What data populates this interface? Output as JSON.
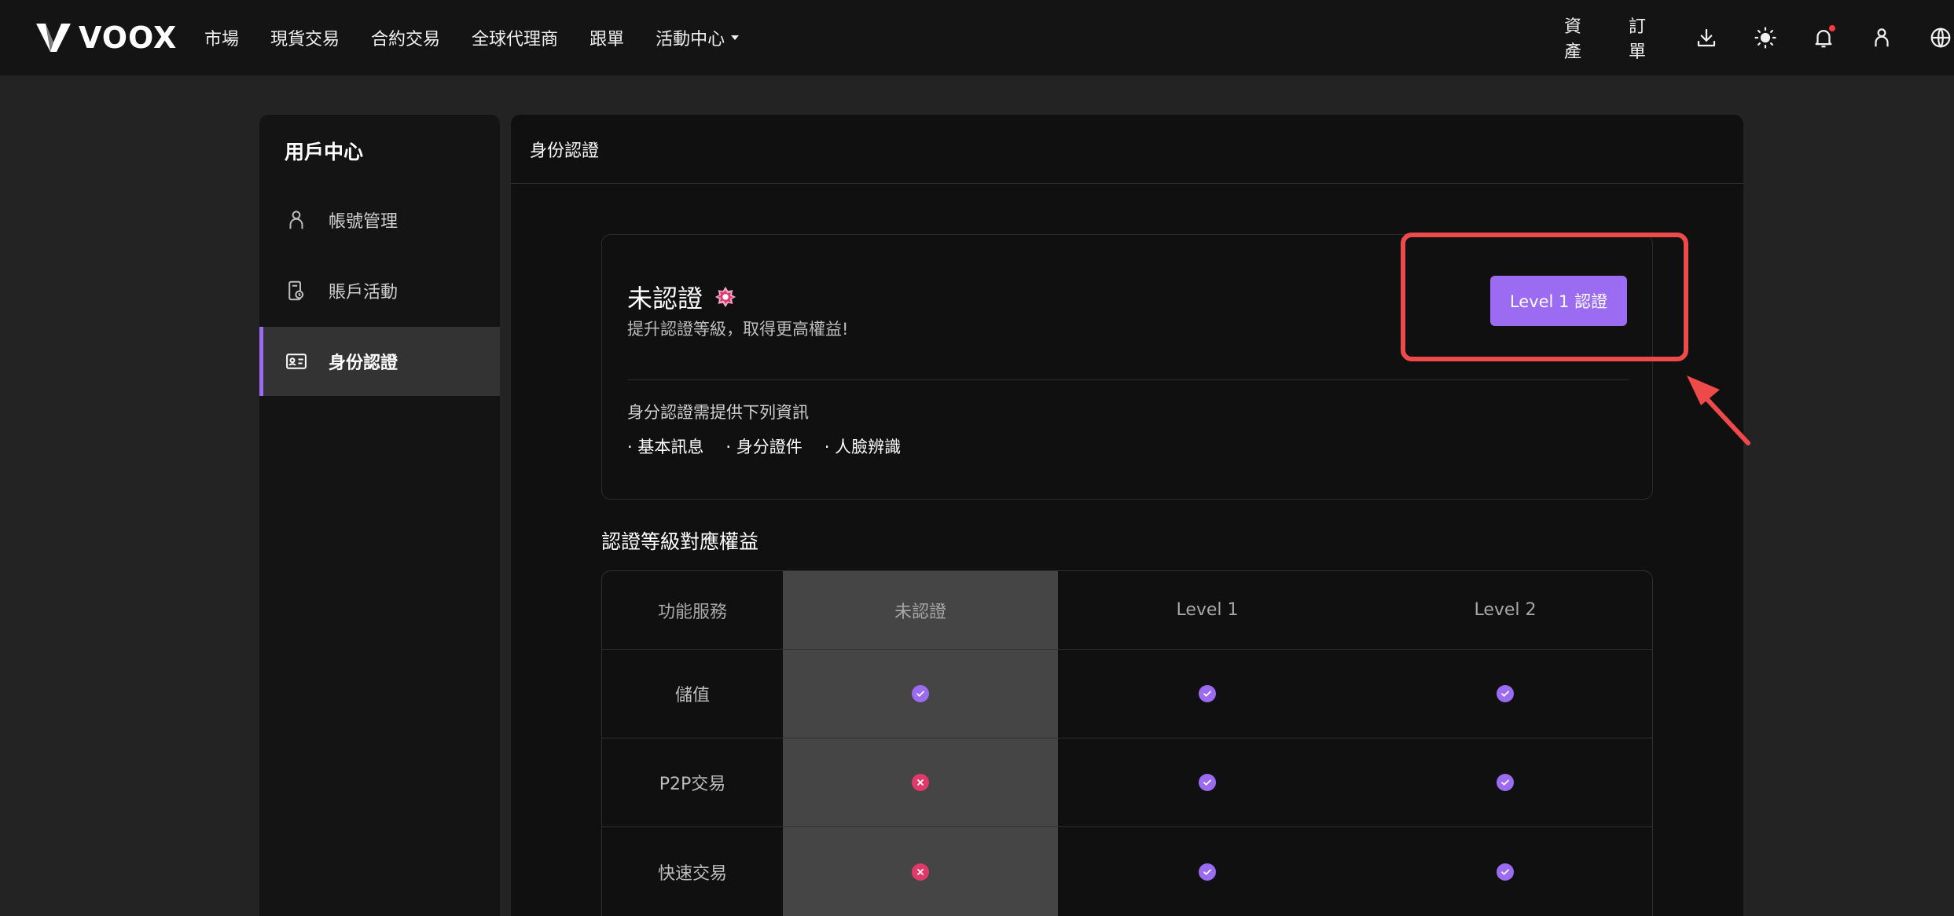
{
  "app": {
    "brand": "VOOX"
  },
  "nav": {
    "items": [
      "市場",
      "現貨交易",
      "合約交易",
      "全球代理商",
      "跟單",
      "活動中心"
    ],
    "right": {
      "assets": "資產",
      "orders": "訂單"
    },
    "icons": [
      "download-icon",
      "sun-icon",
      "bell-icon",
      "user-icon",
      "globe-icon"
    ]
  },
  "sidebar": {
    "title": "用戶中心",
    "items": [
      {
        "label": "帳號管理",
        "icon": "user-icon"
      },
      {
        "label": "賬戶活動",
        "icon": "activity-icon"
      },
      {
        "label": "身份認證",
        "icon": "id-card-icon",
        "active": true
      }
    ]
  },
  "main": {
    "title": "身份認證",
    "status": {
      "title": "未認證",
      "subtitle": "提升認證等級，取得更高權益!",
      "button_label": "Level 1 認證",
      "requirements_title": "身分認證需提供下列資訊",
      "requirements": [
        "· 基本訊息",
        "· 身分證件",
        "· 人臉辨識"
      ]
    },
    "benefits_title": "認證等級對應權益",
    "table": {
      "headers": [
        "功能服務",
        "未認證",
        "Level 1",
        "Level 2"
      ],
      "rows": [
        {
          "label": "儲值",
          "values": [
            true,
            true,
            true
          ]
        },
        {
          "label": "P2P交易",
          "values": [
            false,
            true,
            true
          ]
        },
        {
          "label": "快速交易",
          "values": [
            false,
            true,
            true
          ]
        }
      ]
    }
  },
  "colors": {
    "accent": "#9b6bf2",
    "cross": "#e0396b",
    "highlight": "#ef4a4a"
  }
}
